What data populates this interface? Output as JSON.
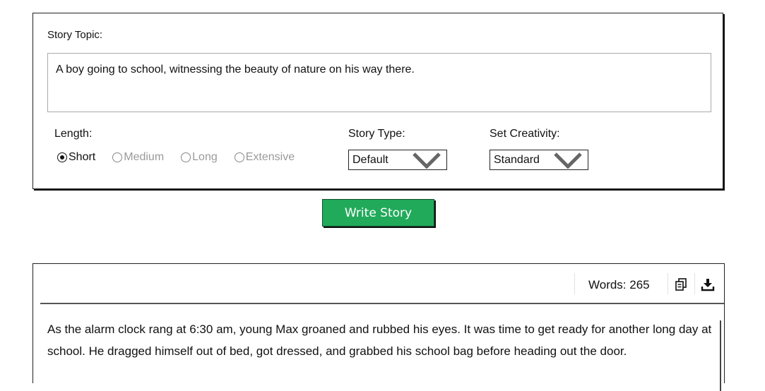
{
  "form": {
    "topic_label": "Story Topic:",
    "topic_value": "A boy going to school, witnessing the beauty of nature on his way there.",
    "length_label": "Length:",
    "length_options": [
      {
        "label": "Short",
        "selected": true
      },
      {
        "label": "Medium",
        "selected": false
      },
      {
        "label": "Long",
        "selected": false
      },
      {
        "label": "Extensive",
        "selected": false
      }
    ],
    "story_type_label": "Story Type:",
    "story_type_value": "Default",
    "creativity_label": "Set Creativity:",
    "creativity_value": "Standard"
  },
  "write_button_label": "Write Story",
  "output": {
    "word_count": "Words: 265",
    "copy_icon": "copy-icon",
    "download_icon": "download-icon",
    "story_text": "As the alarm clock rang at 6:30 am, young Max groaned and rubbed his eyes. It was time to get ready for another long day at school. He dragged himself out of bed, got dressed, and grabbed his school bag before heading out the door."
  },
  "colors": {
    "button_green": "#22aa5b",
    "border_dark": "#222222"
  }
}
